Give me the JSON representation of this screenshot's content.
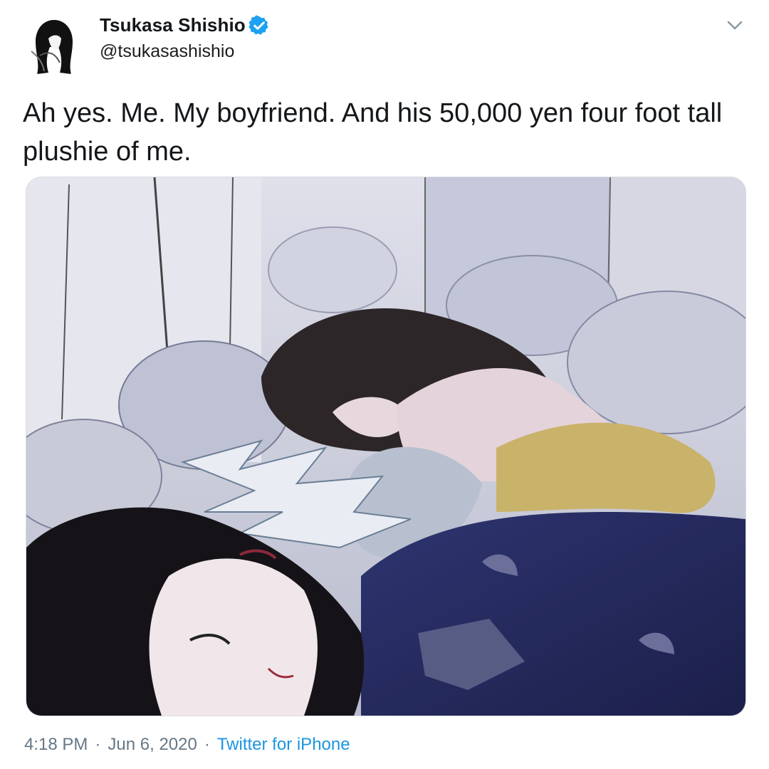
{
  "author": {
    "display_name": "Tsukasa Shishio",
    "handle": "@tsukasashishio",
    "verified": true,
    "avatar_icon": "avatar-portrait"
  },
  "tweet": {
    "text": "Ah yes. Me. My boyfriend. And his 50,000 yen four foot tall plushie of me."
  },
  "media": {
    "type": "illustration",
    "icon": "illustration-image"
  },
  "meta": {
    "time": "4:18 PM",
    "date": "Jun 6, 2020",
    "separator": "·",
    "source": "Twitter for iPhone"
  },
  "icons": {
    "verified": "verified-badge-icon",
    "menu": "chevron-down-icon"
  },
  "colors": {
    "verified_blue": "#1da1f2",
    "link_blue": "#1b95e0",
    "meta_gray": "#657786",
    "text": "#14171a"
  }
}
